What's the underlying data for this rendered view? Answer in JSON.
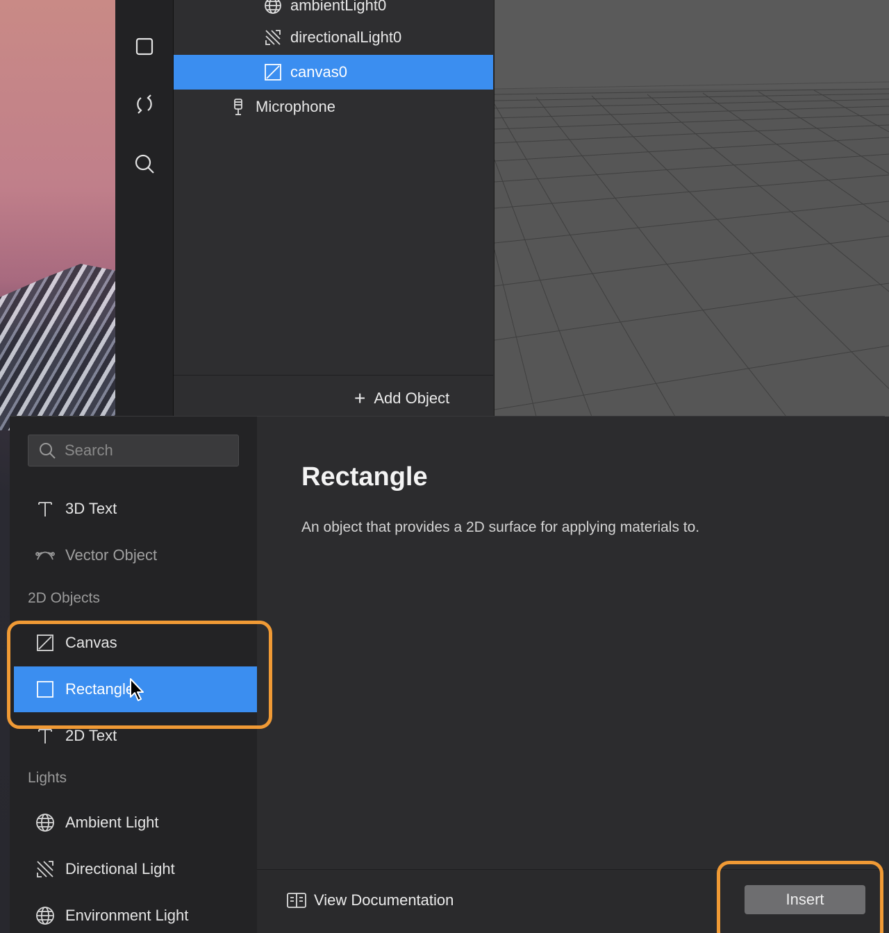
{
  "toolbar": {
    "icons": [
      "square-icon",
      "refresh-icon",
      "search-icon"
    ]
  },
  "scene": {
    "items": [
      {
        "label": "ambientLight0",
        "icon": "globe-icon",
        "selected": false
      },
      {
        "label": "directionalLight0",
        "icon": "directional-light-icon",
        "selected": false
      },
      {
        "label": "canvas0",
        "icon": "canvas-icon",
        "selected": true
      },
      {
        "label": "Microphone",
        "icon": "microphone-icon",
        "selected": false
      }
    ],
    "add_object_label": "Add Object"
  },
  "dialog": {
    "search_placeholder": "Search",
    "library": [
      {
        "type": "item",
        "label": "3D Text",
        "icon": "text-icon"
      },
      {
        "type": "item",
        "label": "Vector Object",
        "icon": "vector-icon",
        "dim": true
      },
      {
        "type": "category",
        "label": "2D Objects"
      },
      {
        "type": "item",
        "label": "Canvas",
        "icon": "canvas-icon"
      },
      {
        "type": "item",
        "label": "Rectangle",
        "icon": "rectangle-icon",
        "selected": true
      },
      {
        "type": "item",
        "label": "2D Text",
        "icon": "text-icon"
      },
      {
        "type": "category",
        "label": "Lights"
      },
      {
        "type": "item",
        "label": "Ambient Light",
        "icon": "globe-icon"
      },
      {
        "type": "item",
        "label": "Directional Light",
        "icon": "directional-light-icon"
      },
      {
        "type": "item",
        "label": "Environment Light",
        "icon": "globe-icon"
      }
    ],
    "detail": {
      "title": "Rectangle",
      "description": "An object that provides a 2D surface for applying materials to."
    },
    "footer": {
      "view_documentation_label": "View Documentation",
      "insert_label": "Insert"
    }
  },
  "colors": {
    "accent": "#3b8ef0",
    "highlight": "#f09a35"
  }
}
